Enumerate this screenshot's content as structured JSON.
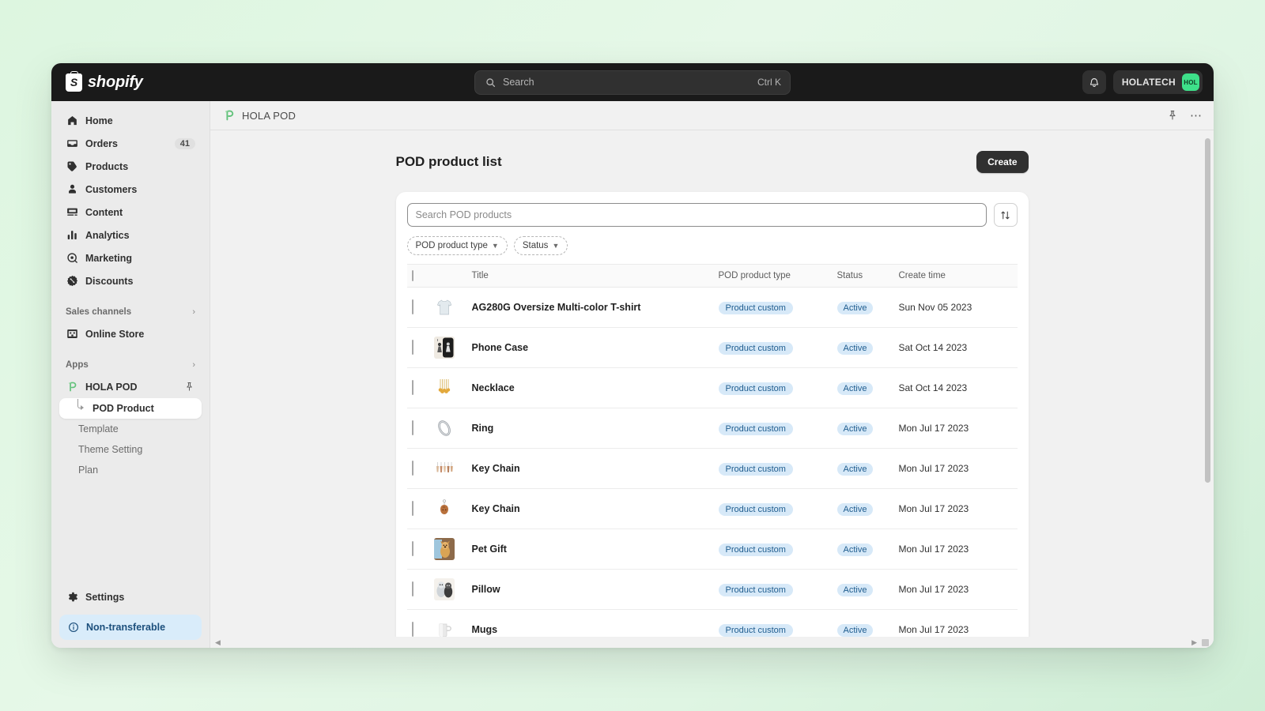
{
  "topbar": {
    "brand_letter": "S",
    "brand_word": "shopify",
    "search_placeholder": "Search",
    "search_shortcut": "Ctrl K",
    "bell_icon": "bell-icon",
    "account_name": "HOLATECH",
    "account_avatar_text": "HOL",
    "accent_avatar_color": "#3ee08a"
  },
  "sidebar": {
    "items": [
      {
        "label": "Home",
        "icon": "home-icon",
        "badge": ""
      },
      {
        "label": "Orders",
        "icon": "orders-icon",
        "badge": "41"
      },
      {
        "label": "Products",
        "icon": "products-icon",
        "badge": ""
      },
      {
        "label": "Customers",
        "icon": "customers-icon",
        "badge": ""
      },
      {
        "label": "Content",
        "icon": "content-icon",
        "badge": ""
      },
      {
        "label": "Analytics",
        "icon": "analytics-icon",
        "badge": ""
      },
      {
        "label": "Marketing",
        "icon": "marketing-icon",
        "badge": ""
      },
      {
        "label": "Discounts",
        "icon": "discounts-icon",
        "badge": ""
      }
    ],
    "sales_channels_header": "Sales channels",
    "sales_channels": [
      {
        "label": "Online Store",
        "icon": "store-icon"
      }
    ],
    "apps_header": "Apps",
    "app_name": "HOLA POD",
    "app_pin_icon": "pin-icon",
    "app_subitems": [
      {
        "label": "POD Product",
        "active": true
      },
      {
        "label": "Template",
        "active": false
      },
      {
        "label": "Theme Setting",
        "active": false
      },
      {
        "label": "Plan",
        "active": false
      }
    ],
    "settings_label": "Settings",
    "settings_icon": "gear-icon",
    "notice_label": "Non-transferable",
    "notice_icon": "info-icon",
    "notice_bg": "#d9ecfa",
    "notice_fg": "#1c4f7c"
  },
  "breadcrumb": {
    "app_logo_icon": "hola-pod-logo-icon",
    "title": "HOLA POD",
    "pin_icon": "pin-icon",
    "more_icon": "more-options-icon"
  },
  "main": {
    "page_title": "POD product list",
    "create_label": "Create",
    "search_placeholder": "Search POD products",
    "search_value": "",
    "sort_icon": "sort-icon",
    "filters": [
      {
        "label": "POD product type",
        "chevron": "chevron-down-icon"
      },
      {
        "label": "Status",
        "chevron": "chevron-down-icon"
      }
    ],
    "columns": {
      "title": "Title",
      "type": "POD product type",
      "status": "Status",
      "time": "Create time"
    },
    "rows": [
      {
        "title": "AG280G Oversize Multi-color T-shirt",
        "type": "Product custom",
        "status": "Active",
        "time": "Sun Nov 05 2023",
        "thumb": "tshirt"
      },
      {
        "title": "Phone Case",
        "type": "Product custom",
        "status": "Active",
        "time": "Sat Oct 14 2023",
        "thumb": "phonecase"
      },
      {
        "title": "Necklace",
        "type": "Product custom",
        "status": "Active",
        "time": "Sat Oct 14 2023",
        "thumb": "necklace"
      },
      {
        "title": "Ring",
        "type": "Product custom",
        "status": "Active",
        "time": "Mon Jul 17 2023",
        "thumb": "ring"
      },
      {
        "title": "Key Chain",
        "type": "Product custom",
        "status": "Active",
        "time": "Mon Jul 17 2023",
        "thumb": "keychain1"
      },
      {
        "title": "Key Chain",
        "type": "Product custom",
        "status": "Active",
        "time": "Mon Jul 17 2023",
        "thumb": "keychain2"
      },
      {
        "title": "Pet Gift",
        "type": "Product custom",
        "status": "Active",
        "time": "Mon Jul 17 2023",
        "thumb": "petgift"
      },
      {
        "title": "Pillow",
        "type": "Product custom",
        "status": "Active",
        "time": "Mon Jul 17 2023",
        "thumb": "pillow"
      },
      {
        "title": "Mugs",
        "type": "Product custom",
        "status": "Active",
        "time": "Mon Jul 17 2023",
        "thumb": "mug"
      }
    ],
    "pill_bg": "#d7e9f8",
    "pill_fg": "#1f5d8f"
  }
}
